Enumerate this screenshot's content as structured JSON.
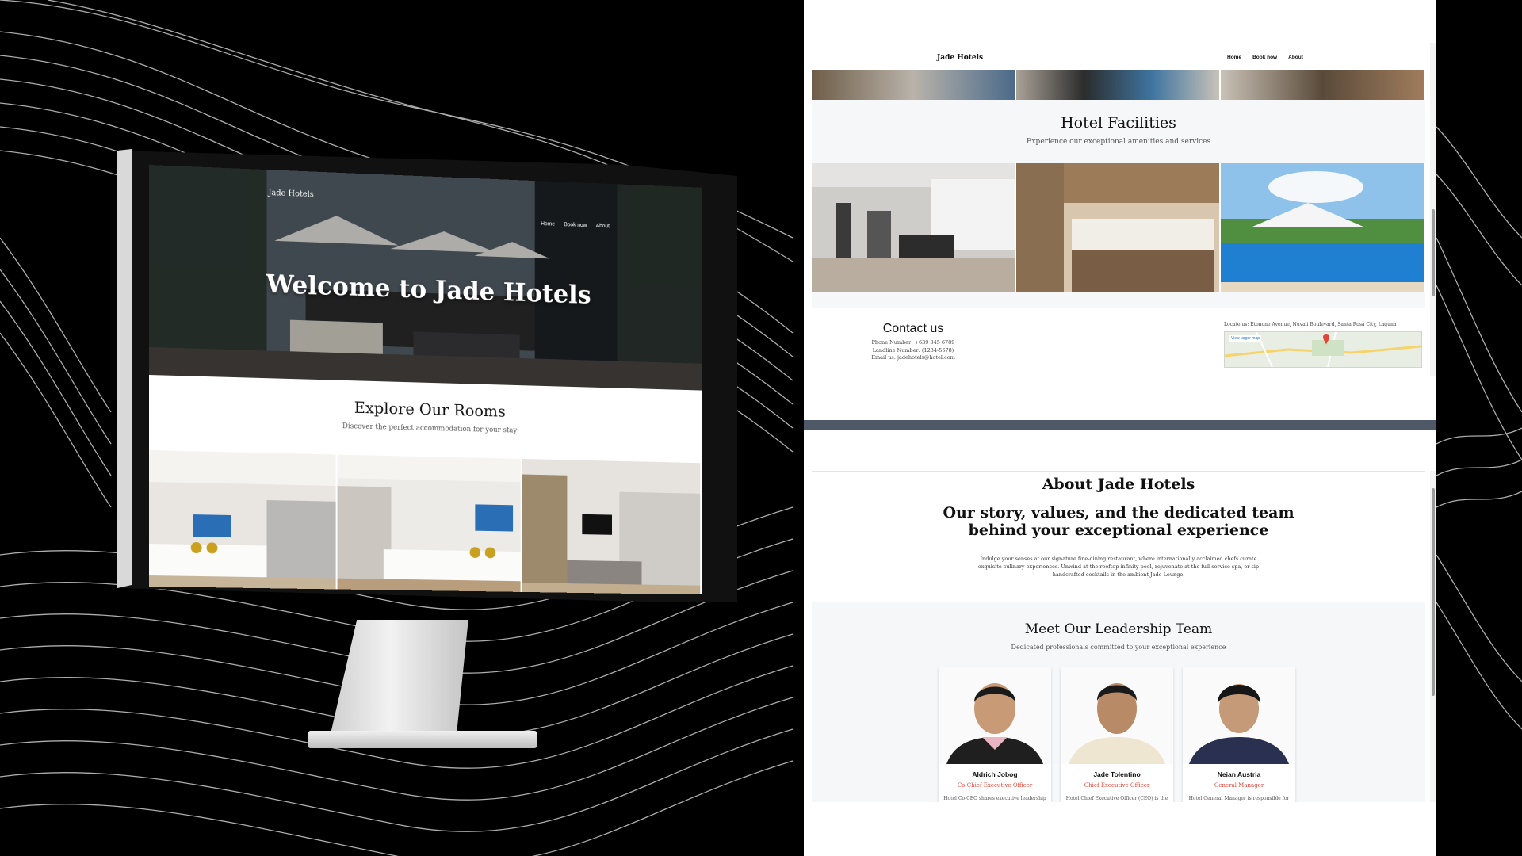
{
  "monitor": {
    "hero": {
      "brand": "Jade Hotels",
      "nav": [
        "Home",
        "Book now",
        "About"
      ],
      "title": "Welcome to Jade Hotels"
    },
    "explore": {
      "title": "Explore Our Rooms",
      "subtitle": "Discover the perfect accommodation for your stay"
    }
  },
  "page_top": {
    "brand": "Jade Hotels",
    "nav": [
      "Home",
      "Book now",
      "About"
    ],
    "facilities": {
      "title": "Hotel Facilities",
      "subtitle": "Experience our exceptional amenities and services"
    },
    "contact": {
      "title": "Contact us",
      "phone": "Phone Number: +639 345 6789",
      "landline": "Landline Number: (1234-5678)",
      "email": "Email us: jadehotels@hotel.com",
      "locate": "Locate us: Etonone Avenue, Nuvali Boulevard, Santa Rosa City, Laguna",
      "map_label": "View larger map"
    }
  },
  "page_bottom": {
    "about_title": "About Jade Hotels",
    "about_tagline": "Our story, values, and the dedicated team behind your exceptional experience",
    "about_text": "Indulge your senses at our signature fine-dining restaurant, where internationally acclaimed chefs curate exquisite culinary experiences. Unwind at the rooftop infinity pool, rejuvenate at the full-service spa, or sip handcrafted cocktails in the ambient Jade Lounge.",
    "leaders_title": "Meet Our Leadership Team",
    "leaders_subtitle": "Dedicated professionals committed to your exceptional experience",
    "leaders": [
      {
        "name": "Aldrich Jobog",
        "role": "Co-Chief Executive Officer",
        "desc": "Hotel Co-CEO shares executive leadership",
        "shirt": "#1f1f1f",
        "collar": "#e7b6c2"
      },
      {
        "name": "Jade Tolentino",
        "role": "Chief Executive Officer",
        "desc": "Hotel Chief Executive Officer (CEO) is the",
        "shirt": "#efe6d2",
        "collar": "#efe6d2"
      },
      {
        "name": "Neian Austria",
        "role": "General Manager",
        "desc": "Hotel General Manager is responsible for",
        "shirt": "#2a3150",
        "collar": "#2a3150"
      }
    ]
  },
  "colors": {
    "accent_red": "#e0463a",
    "divider": "#4f5866",
    "section_bg": "#f6f7f9"
  }
}
